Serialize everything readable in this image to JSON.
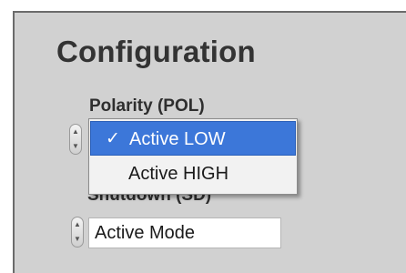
{
  "panel": {
    "title": "Configuration"
  },
  "polarity": {
    "label": "Polarity (POL)",
    "options": [
      {
        "label": "Active LOW",
        "selected": true,
        "check": "✓"
      },
      {
        "label": "Active HIGH",
        "selected": false
      }
    ]
  },
  "shutdown": {
    "label": "Shutdown (SD)",
    "value": "Active Mode"
  },
  "colors": {
    "panel_bg": "#d1d1d1",
    "selection_bg": "#3c77d9"
  },
  "icons": {
    "stepper_up": "up-arrow-icon",
    "stepper_down": "down-arrow-icon",
    "check": "checkmark-icon"
  }
}
